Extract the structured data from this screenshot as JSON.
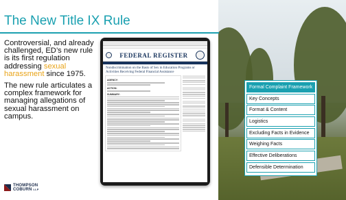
{
  "slide": {
    "title": "The New Title IX Rule",
    "paragraph1": {
      "before": "Controversial, and already challenged, ED’s new rule is its first regulation addressing ",
      "highlight": "sexual harassment",
      "after": " since 1975."
    },
    "paragraph2": "The new rule articulates a complex framework for managing allegations of sexual harassment on campus.",
    "accent_color": "#1aa0b0",
    "highlight_color": "#e8a317"
  },
  "logo": {
    "line1": "THOMPSON",
    "line2": "COBURN",
    "suffix": "LLP"
  },
  "tablet": {
    "masthead": "FEDERAL REGISTER",
    "document_title": "Nondiscrimination on the Basis of Sex in Education Programs or Activities Receiving Federal Financial Assistance",
    "sections": [
      "AGENCY:",
      "ACTION:",
      "SUMMARY:"
    ]
  },
  "outline": {
    "items": [
      "Formal Complaint Framework",
      "Key Concepts",
      "Format & Content",
      "Logistics",
      "Excluding Facts in Evidence",
      "Weighing Facts",
      "Effective Deliberations",
      "Defensible Determination"
    ],
    "active_index": 0
  }
}
